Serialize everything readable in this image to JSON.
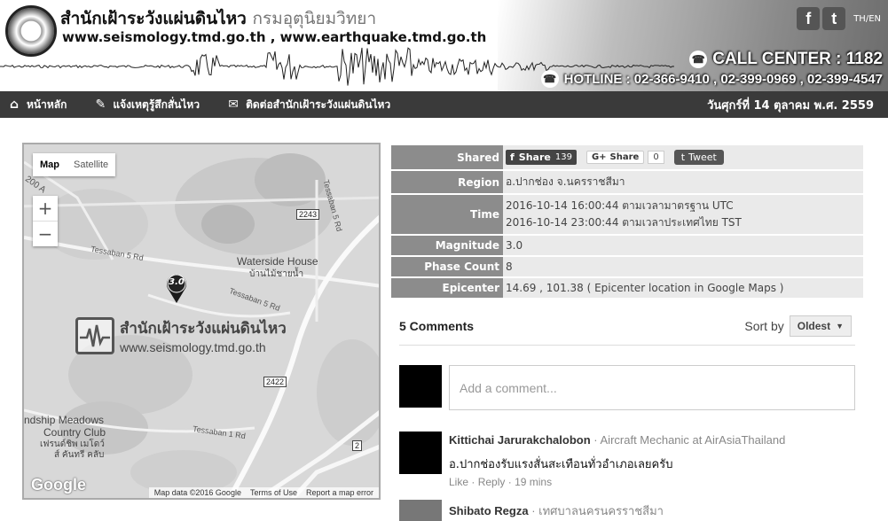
{
  "header": {
    "org_name": "สำนักเฝ้าระวังแผ่นดินไหว",
    "dept_name": "กรมอุตุนิยมวิทยา",
    "urls": "www.seismology.tmd.go.th , www.earthquake.tmd.go.th",
    "lang": "TH/EN",
    "call_center": "CALL CENTER : 1182",
    "hotline": "HOTLINE : 02-366-9410 , 02-399-0969 , 02-399-4547",
    "icons": [
      "facebook-icon",
      "twitter-icon",
      "phone-icon"
    ]
  },
  "nav": {
    "items": [
      {
        "label": "หน้าหลัก",
        "icon": "home-icon"
      },
      {
        "label": "แจ้งเหตุรู้สึกสั่นไหว",
        "icon": "report-icon"
      },
      {
        "label": "ติดต่อสำนักเฝ้าระวังแผ่นดินไหว",
        "icon": "mail-icon"
      }
    ],
    "date": "วันศุกร์ที่ 14 ตุลาคม พ.ศ. 2559"
  },
  "map": {
    "type_map": "Map",
    "type_satellite": "Satellite",
    "zoom_in": "+",
    "zoom_out": "−",
    "marker_label": "3.0",
    "labels": {
      "tessaban5_a": "Tessaban 5 Rd",
      "tessaban5_b": "Tessaban 5 Rd",
      "tessaban1": "Tessaban 1 Rd",
      "tessaban5_c": "Tessaban 5 Rd",
      "waterside": "Waterside House",
      "waterside_th": "บ้านไม้ชายน้ำ",
      "meadows": "ndship Meadows",
      "country_club": "Country Club",
      "meadows_th": "เฟรนด์ชิพ เมโดว์",
      "meadows_th2": "ส์ คันทรี คลับ",
      "edge_200": "200 A"
    },
    "shields": {
      "r2243": "2243",
      "r2422": "2422",
      "r2": "2"
    },
    "watermark_title": "สำนักเฝ้าระวังแผ่นดินไหว",
    "watermark_url": "www.seismology.tmd.go.th",
    "google": "Google",
    "footer": {
      "data": "Map data ©2016 Google",
      "terms": "Terms of Use",
      "report": "Report a map error"
    }
  },
  "info": {
    "shared": {
      "label": "Shared",
      "fb_label": "Share",
      "fb_count": "139",
      "gp_label": "Share",
      "gp_count": "0",
      "tweet": "Tweet"
    },
    "region": {
      "label": "Region",
      "value": "อ.ปากช่อง จ.นครราชสีมา"
    },
    "time": {
      "label": "Time",
      "utc": "2016-10-14 16:00:44 ตามเวลามาตรฐาน UTC",
      "tst": "2016-10-14 23:00:44 ตามเวลาประเทศไทย TST"
    },
    "magnitude": {
      "label": "Magnitude",
      "value": "3.0"
    },
    "phase_count": {
      "label": "Phase Count",
      "value": "8"
    },
    "epicenter": {
      "label": "Epicenter",
      "value": "14.69 , 101.38 ( Epicenter location in Google Maps )"
    }
  },
  "comments": {
    "count_label": "5 Comments",
    "sort_label": "Sort by",
    "sort_value": "Oldest",
    "add_placeholder": "Add a comment...",
    "items": [
      {
        "name": "Kittichai Jarurakchalobon",
        "role": "· Aircraft Mechanic at AirAsiaThailand",
        "text": "อ.ปากช่องรับแรงสั่นสะเทือนทั่วอำเภอเลยครับ",
        "like": "Like",
        "reply": "Reply",
        "time": "19 mins"
      },
      {
        "name": "Shibato Regza",
        "role": "· เทศบาลนครนครราชสีมา"
      }
    ]
  }
}
